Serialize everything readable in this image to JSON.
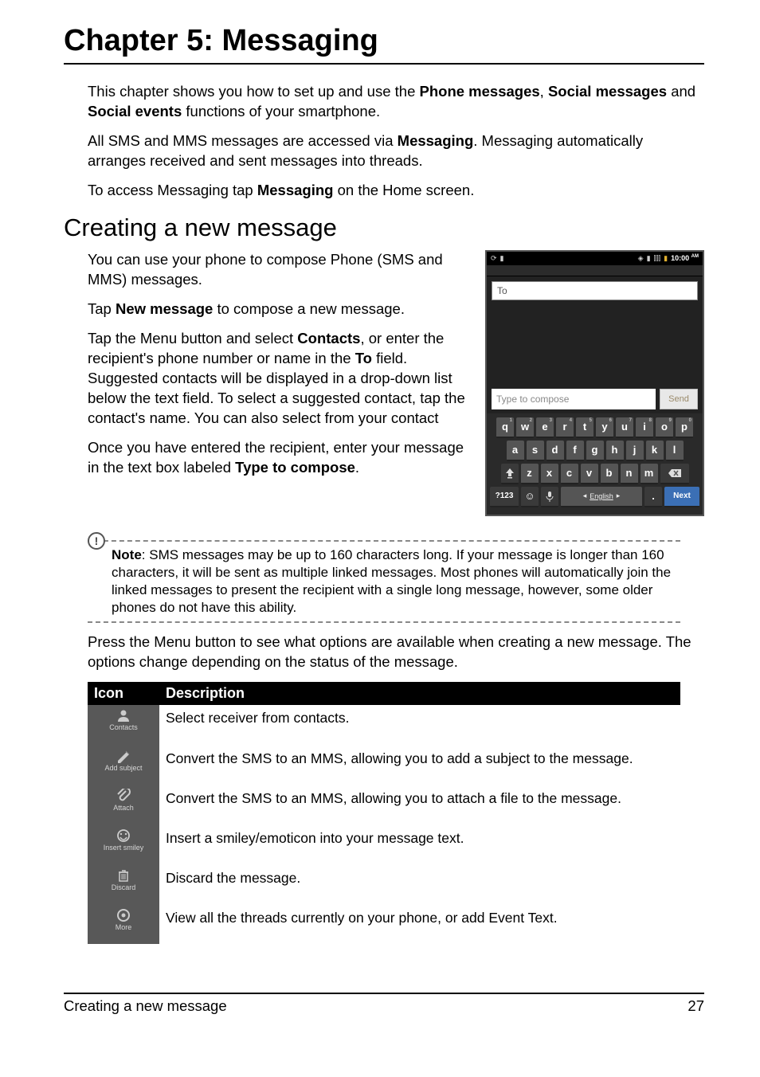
{
  "chapter_title": "Chapter 5: Messaging",
  "intro": {
    "p1a": "This chapter shows you how to set up and use the ",
    "p1b": "Phone messages",
    "p1c": ", ",
    "p1d": "Social messages",
    "p1e": " and ",
    "p1f": "Social events",
    "p1g": " functions of your smartphone.",
    "p2a": "All SMS and MMS messages are accessed via ",
    "p2b": "Messaging",
    "p2c": ". Messaging automatically arranges received and sent messages into threads.",
    "p3a": "To access Messaging tap ",
    "p3b": "Messaging",
    "p3c": " on the Home screen."
  },
  "section_title": "Creating a new message",
  "body": {
    "p1": "You can use your phone to compose Phone (SMS and MMS) messages.",
    "p2a": "Tap ",
    "p2b": "New message",
    "p2c": " to compose a new message.",
    "p3a": "Tap the Menu button and select ",
    "p3b": "Contacts",
    "p3c": ", or enter the recipient's phone number or name in the ",
    "p3d": "To",
    "p3e": " field. Suggested contacts will be displayed in a drop-down list below the text field. To select a suggested contact, tap the contact's name. You can also select from your contact",
    "p4a": "Once you have entered the recipient, enter your message in the text box labeled ",
    "p4b": "Type to compose",
    "p4c": "."
  },
  "phone": {
    "clock": "10:00",
    "clock_ampm": "AM",
    "to_placeholder": "To",
    "compose_placeholder": "Type to compose",
    "send_label": "Send",
    "rows": {
      "r1": [
        "q",
        "w",
        "e",
        "r",
        "t",
        "y",
        "u",
        "i",
        "o",
        "p"
      ],
      "r1sup": [
        "1",
        "2",
        "3",
        "4",
        "5",
        "6",
        "7",
        "8",
        "9",
        "0"
      ],
      "r2": [
        "a",
        "s",
        "d",
        "f",
        "g",
        "h",
        "j",
        "k",
        "l"
      ],
      "r3": [
        "z",
        "x",
        "c",
        "v",
        "b",
        "n",
        "m"
      ]
    },
    "sym_key": "?123",
    "space_label": "English",
    "dot_key": ".",
    "next_key": "Next"
  },
  "note": {
    "label": "Note",
    "text": ": SMS messages may be up to 160 characters long. If your message is longer than 160 characters, it will be sent as multiple linked messages. Most phones will automatically join the linked messages to present the recipient with a single long message, however, some older phones do not have this ability."
  },
  "after_note": "Press the Menu button to see what options are available when creating a new message. The options change depending on the status of the message.",
  "table": {
    "h1": "Icon",
    "h2": "Description",
    "rows": [
      {
        "icon_label": "Contacts",
        "icon_name": "contacts-icon",
        "desc": "Select receiver from contacts."
      },
      {
        "icon_label": "Add subject",
        "icon_name": "add-subject-icon",
        "desc": "Convert the SMS to an MMS, allowing you to add a subject to the message."
      },
      {
        "icon_label": "Attach",
        "icon_name": "attach-icon",
        "desc": "Convert the SMS to an MMS, allowing you to attach a file to the message."
      },
      {
        "icon_label": "Insert smiley",
        "icon_name": "insert-smiley-icon",
        "desc": "Insert a smiley/emoticon into your message text."
      },
      {
        "icon_label": "Discard",
        "icon_name": "discard-icon",
        "desc": "Discard the message."
      },
      {
        "icon_label": "More",
        "icon_name": "more-icon",
        "desc": "View all the threads currently on your phone, or add Event Text."
      }
    ]
  },
  "footer": {
    "left": "Creating a new message",
    "right": "27"
  }
}
